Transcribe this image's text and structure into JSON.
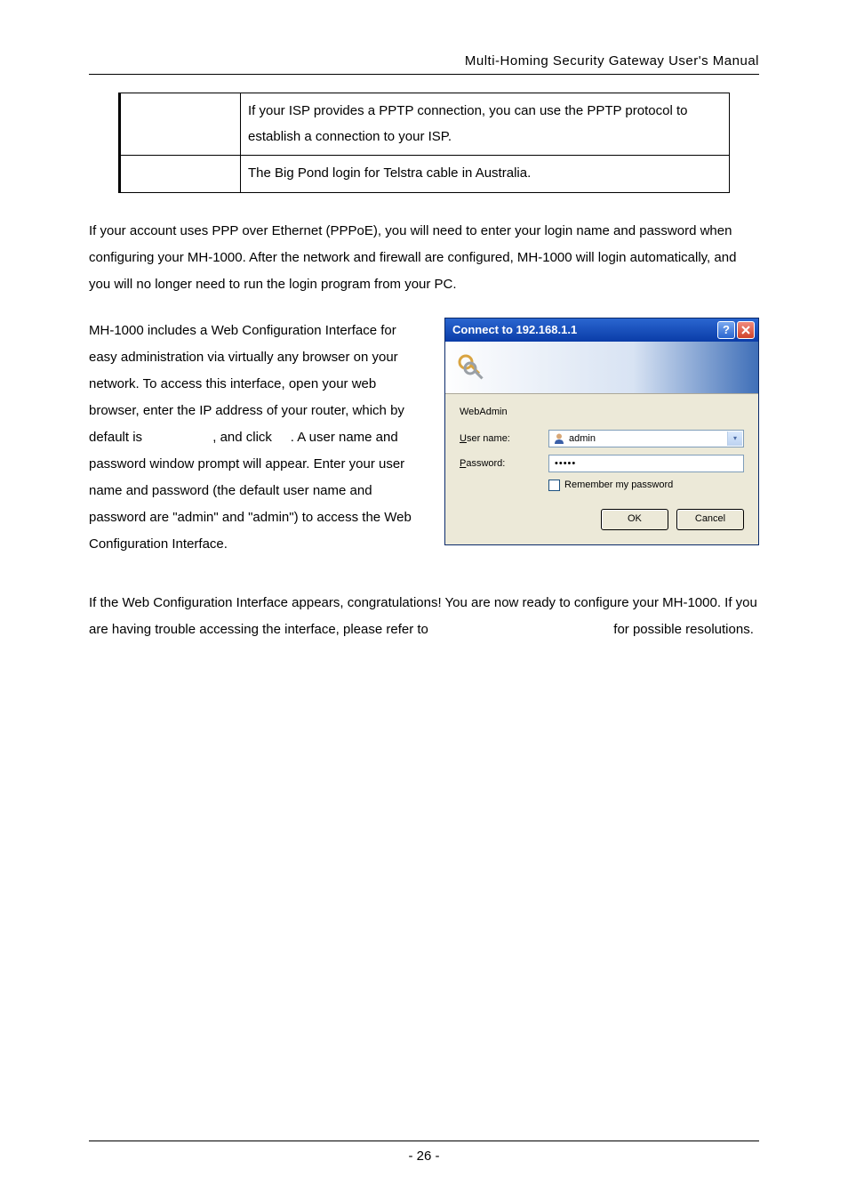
{
  "header": {
    "title": "Multi-Homing  Security  Gateway  User's  Manual"
  },
  "table_rows": [
    {
      "c1": "",
      "c2": "If your ISP provides a PPTP connection, you can use the PPTP protocol to establish a connection to your ISP."
    },
    {
      "c1": "",
      "c2": "The Big Pond login for Telstra cable in Australia."
    }
  ],
  "para1": "If your account uses PPP over Ethernet (PPPoE), you will need to enter your login name and password when configuring your MH-1000. After the network and firewall are configured, MH-1000 will login automatically, and you will no longer need to run the login program from your PC.",
  "para2_a": "MH-1000 includes a Web Configuration Interface for easy administration via virtually any browser on your network. To access this interface, open your web browser, enter the IP address of your router, which by default is ",
  "para2_b": ", and click ",
  "para2_c": ". A user name and password window prompt will appear. Enter your user name and password (the default user name and password are \"admin\" and \"admin\") to access the Web Configuration Interface.",
  "dialog": {
    "title": "Connect to 192.168.1.1",
    "realm": "WebAdmin",
    "user_label_u": "U",
    "user_label_rest": "ser name:",
    "pass_label_p": "P",
    "pass_label_rest": "assword:",
    "user_value": "admin",
    "pass_value": "•••••",
    "remember_r": "R",
    "remember_rest": "emember my password",
    "ok": "OK",
    "cancel": "Cancel"
  },
  "para3_a": "If the Web Configuration Interface appears, congratulations! You are now ready to configure your MH-1000. If you are having trouble accessing the interface, please refer to ",
  "para3_b": " for possible resolutions.",
  "footer": {
    "page": "- 26 -"
  }
}
